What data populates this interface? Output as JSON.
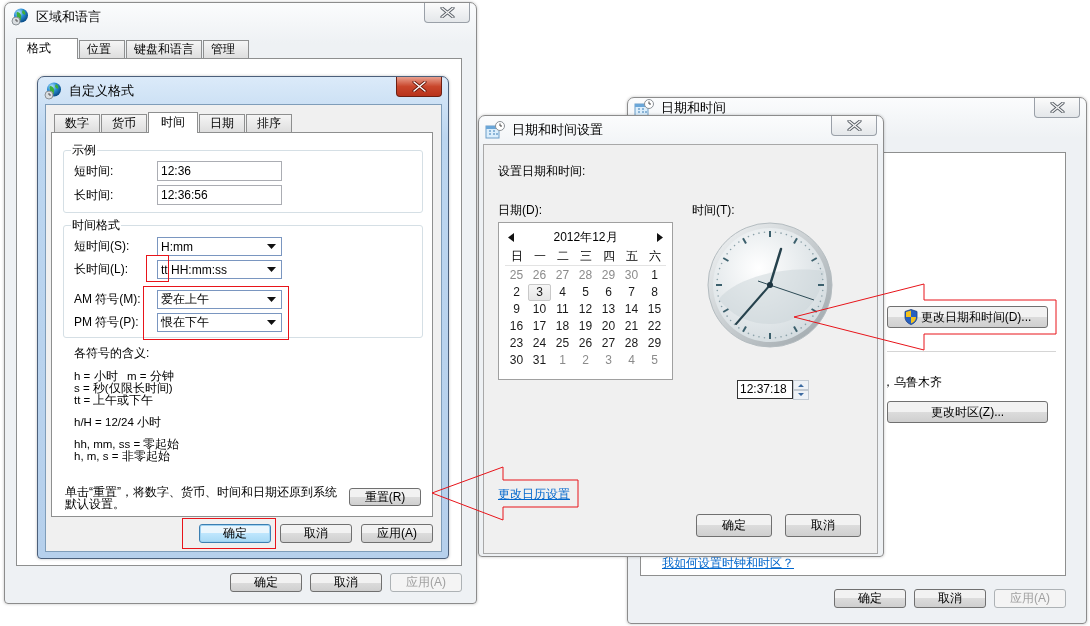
{
  "region_window": {
    "title": "区域和语言",
    "tabs": [
      {
        "label": "格式",
        "selected": true
      },
      {
        "label": "位置",
        "selected": false
      },
      {
        "label": "键盘和语言",
        "selected": false
      },
      {
        "label": "管理",
        "selected": false
      }
    ],
    "buttons": [
      {
        "label": "确定",
        "disabled": false
      },
      {
        "label": "取消",
        "disabled": false
      },
      {
        "label": "应用(A)",
        "disabled": true
      }
    ]
  },
  "custom_format_dialog": {
    "title": "自定义格式",
    "tabs": [
      {
        "label": "数字",
        "selected": false
      },
      {
        "label": "货币",
        "selected": false
      },
      {
        "label": "时间",
        "selected": true
      },
      {
        "label": "日期",
        "selected": false
      },
      {
        "label": "排序",
        "selected": false
      }
    ],
    "sample": {
      "title": "示例",
      "rows": [
        {
          "label": "短时间:",
          "value": "12:36"
        },
        {
          "label": "长时间:",
          "value": "12:36:56"
        }
      ]
    },
    "time_formats": {
      "title": "时间格式",
      "rows": [
        {
          "label": "短时间(S):",
          "value": "H:mm"
        },
        {
          "label": "长时间(L):",
          "value": "tt HH:mm:ss"
        },
        {
          "label": "AM 符号(M):",
          "value": "爱在上午"
        },
        {
          "label": "PM 符号(P):",
          "value": "恨在下午"
        }
      ]
    },
    "symbol_legend": {
      "title": "各符号的含义:",
      "groups": [
        [
          "h = 小时   m = 分钟",
          "s = 秒(仅限长时间)",
          "tt = 上午或下午"
        ],
        [
          "h/H = 12/24 小时"
        ],
        [
          "hh, mm, ss = 零起始",
          "h, m, s = 非零起始"
        ]
      ]
    },
    "reset_note": "单击“重置”，将数字、货币、时间和日期还原到系统默认设置。",
    "reset_button": "重置(R)",
    "buttons": [
      {
        "label": "确定",
        "disabled": false,
        "default": true
      },
      {
        "label": "取消",
        "disabled": false,
        "default": false
      },
      {
        "label": "应用(A)",
        "disabled": false,
        "default": false
      }
    ]
  },
  "date_time_window": {
    "title": "日期和时间",
    "change_datetime_button": "更改日期和时间(D)...",
    "timezone_text": "，乌鲁木齐",
    "change_timezone_button": "更改时区(Z)...",
    "help_link": "我如何设置时钟和时区？",
    "buttons": [
      {
        "label": "确定",
        "disabled": false
      },
      {
        "label": "取消",
        "disabled": false
      },
      {
        "label": "应用(A)",
        "disabled": true
      }
    ]
  },
  "date_time_settings_dialog": {
    "title": "日期和时间设置",
    "heading": "设置日期和时间:",
    "date_label": "日期(D):",
    "time_label": "时间(T):",
    "calendar": {
      "month": "2012年12月",
      "weekdays": [
        "日",
        "一",
        "二",
        "三",
        "四",
        "五",
        "六"
      ],
      "days": [
        {
          "text": "25",
          "other_month": true,
          "selected": false
        },
        {
          "text": "26",
          "other_month": true,
          "selected": false
        },
        {
          "text": "27",
          "other_month": true,
          "selected": false
        },
        {
          "text": "28",
          "other_month": true,
          "selected": false
        },
        {
          "text": "29",
          "other_month": true,
          "selected": false
        },
        {
          "text": "30",
          "other_month": true,
          "selected": false
        },
        {
          "text": "1",
          "other_month": false,
          "selected": false
        },
        {
          "text": "2",
          "other_month": false,
          "selected": false
        },
        {
          "text": "3",
          "other_month": false,
          "selected": true
        },
        {
          "text": "4",
          "other_month": false,
          "selected": false
        },
        {
          "text": "5",
          "other_month": false,
          "selected": false
        },
        {
          "text": "6",
          "other_month": false,
          "selected": false
        },
        {
          "text": "7",
          "other_month": false,
          "selected": false
        },
        {
          "text": "8",
          "other_month": false,
          "selected": false
        },
        {
          "text": "9",
          "other_month": false,
          "selected": false
        },
        {
          "text": "10",
          "other_month": false,
          "selected": false
        },
        {
          "text": "11",
          "other_month": false,
          "selected": false
        },
        {
          "text": "12",
          "other_month": false,
          "selected": false
        },
        {
          "text": "13",
          "other_month": false,
          "selected": false
        },
        {
          "text": "14",
          "other_month": false,
          "selected": false
        },
        {
          "text": "15",
          "other_month": false,
          "selected": false
        },
        {
          "text": "16",
          "other_month": false,
          "selected": false
        },
        {
          "text": "17",
          "other_month": false,
          "selected": false
        },
        {
          "text": "18",
          "other_month": false,
          "selected": false
        },
        {
          "text": "19",
          "other_month": false,
          "selected": false
        },
        {
          "text": "20",
          "other_month": false,
          "selected": false
        },
        {
          "text": "21",
          "other_month": false,
          "selected": false
        },
        {
          "text": "22",
          "other_month": false,
          "selected": false
        },
        {
          "text": "23",
          "other_month": false,
          "selected": false
        },
        {
          "text": "24",
          "other_month": false,
          "selected": false
        },
        {
          "text": "25",
          "other_month": false,
          "selected": false
        },
        {
          "text": "26",
          "other_month": false,
          "selected": false
        },
        {
          "text": "27",
          "other_month": false,
          "selected": false
        },
        {
          "text": "28",
          "other_month": false,
          "selected": false
        },
        {
          "text": "29",
          "other_month": false,
          "selected": false
        },
        {
          "text": "30",
          "other_month": false,
          "selected": false
        },
        {
          "text": "31",
          "other_month": false,
          "selected": false
        },
        {
          "text": "1",
          "other_month": true,
          "selected": false
        },
        {
          "text": "2",
          "other_month": true,
          "selected": false
        },
        {
          "text": "3",
          "other_month": true,
          "selected": false
        },
        {
          "text": "4",
          "other_month": true,
          "selected": false
        },
        {
          "text": "5",
          "other_month": true,
          "selected": false
        }
      ]
    },
    "time_value": "12:37:18",
    "calendar_link": "更改日历设置",
    "buttons": [
      {
        "label": "确定",
        "disabled": false
      },
      {
        "label": "取消",
        "disabled": false
      }
    ]
  }
}
